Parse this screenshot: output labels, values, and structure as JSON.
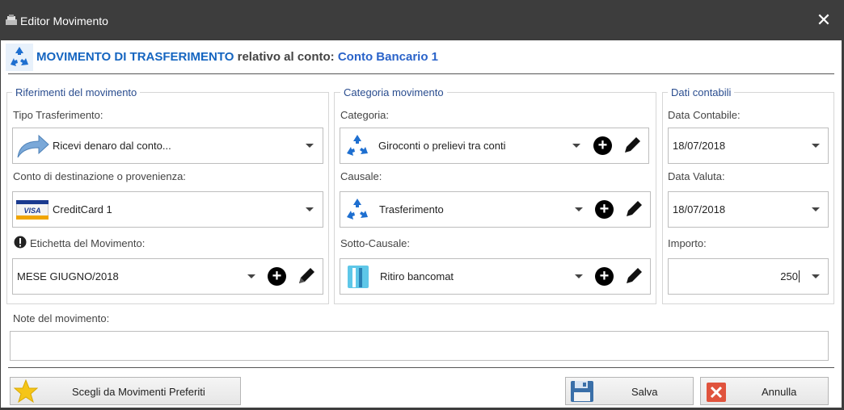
{
  "window": {
    "title": "Editor Movimento"
  },
  "header": {
    "type_label": "MOVIMENTO DI TRASFERIMENTO",
    "relative_label": "relativo al conto:",
    "account": "Conto Bancario 1"
  },
  "riferimenti": {
    "title": "Riferimenti del movimento",
    "tipo_label": "Tipo Trasferimento:",
    "tipo_value": "Ricevi denaro dal conto...",
    "conto_label": "Conto di destinazione o provenienza:",
    "conto_value": "CreditCard 1",
    "etichetta_label": "Etichetta del Movimento:",
    "etichetta_value": "MESE GIUGNO/2018"
  },
  "categoria": {
    "title": "Categoria movimento",
    "categoria_label": "Categoria:",
    "categoria_value": "Giroconti o prelievi tra conti",
    "causale_label": "Causale:",
    "causale_value": "Trasferimento",
    "sottocausale_label": "Sotto-Causale:",
    "sottocausale_value": "Ritiro bancomat"
  },
  "contabili": {
    "title": "Dati contabili",
    "data_contabile_label": "Data Contabile:",
    "data_contabile_value": "18/07/2018",
    "data_valuta_label": "Data Valuta:",
    "data_valuta_value": "18/07/2018",
    "importo_label": "Importo:",
    "importo_value": "250"
  },
  "note": {
    "label": "Note del movimento:",
    "value": ""
  },
  "buttons": {
    "preferiti": "Scegli da Movimenti Preferiti",
    "salva": "Salva",
    "annulla": "Annulla"
  },
  "icons": {
    "close": "close-icon",
    "header": "recycle-icon",
    "arrow": "arrow-icon",
    "visa": "visa-card-icon",
    "warning": "exclamation-icon",
    "star": "star-icon",
    "save": "floppy-icon",
    "cancel": "x-icon"
  },
  "colors": {
    "titlebar": "#3d3d3d",
    "accent_blue": "#1565c0",
    "group_title": "#2a4d8f",
    "recycle": "#1e6fd0",
    "cancel_red": "#e0533d",
    "star": "#f5c518"
  }
}
